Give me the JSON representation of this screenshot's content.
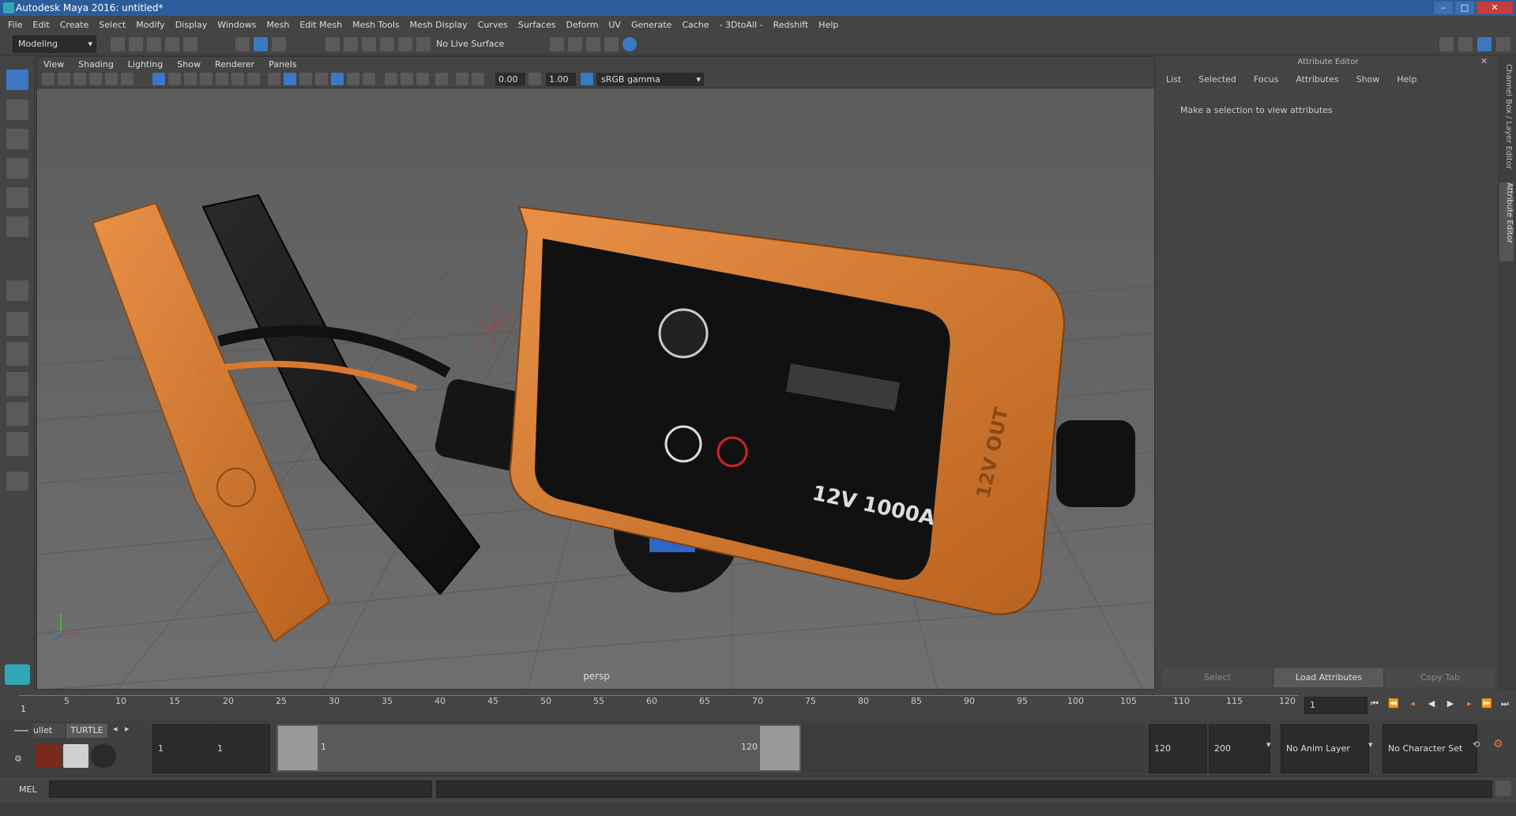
{
  "window": {
    "title": "Autodesk Maya 2016: untitled*"
  },
  "menubar": [
    "File",
    "Edit",
    "Create",
    "Select",
    "Modify",
    "Display",
    "Windows",
    "Mesh",
    "Edit Mesh",
    "Mesh Tools",
    "Mesh Display",
    "Curves",
    "Surfaces",
    "Deform",
    "UV",
    "Generate",
    "Cache",
    "- 3DtoAll -",
    "Redshift",
    "Help"
  ],
  "shelf": {
    "mode": "Modeling",
    "live_surface": "No Live Surface"
  },
  "viewport": {
    "menu": [
      "View",
      "Shading",
      "Lighting",
      "Show",
      "Renderer",
      "Panels"
    ],
    "exposure": "0.00",
    "gamma": "1.00",
    "colorspace": "sRGB gamma",
    "camera": "persp",
    "model_text": {
      "rating": "12V 1000A",
      "out": "12V OUT"
    }
  },
  "attribute_editor": {
    "title": "Attribute Editor",
    "menu": [
      "List",
      "Selected",
      "Focus",
      "Attributes",
      "Show",
      "Help"
    ],
    "message": "Make a selection to view attributes",
    "buttons": {
      "select": "Select",
      "load": "Load Attributes",
      "copy": "Copy Tab"
    },
    "side_tabs": {
      "channel": "Channel Box / Layer Editor",
      "attr": "Attribute Editor"
    }
  },
  "timeline": {
    "ticks": [
      "5",
      "10",
      "15",
      "20",
      "25",
      "30",
      "35",
      "40",
      "45",
      "50",
      "55",
      "60",
      "65",
      "70",
      "75",
      "80",
      "85",
      "90",
      "95",
      "100",
      "105",
      "110",
      "115",
      "120"
    ],
    "start_label": "1",
    "current_frame": "1"
  },
  "range": {
    "shelf_tabs": [
      "ullet",
      "TURTLE"
    ],
    "start": "1",
    "playback_start": "1",
    "slider_start": "1",
    "slider_end": "120",
    "playback_end": "120",
    "end": "200",
    "anim_layer": "No Anim Layer",
    "character_set": "No Character Set"
  },
  "cmdline": {
    "label": "MEL"
  },
  "colors": {
    "accent": "#3b79c3",
    "orange": "#d9782f",
    "title_blue": "#2b5d9c",
    "viewport": "#676767"
  }
}
